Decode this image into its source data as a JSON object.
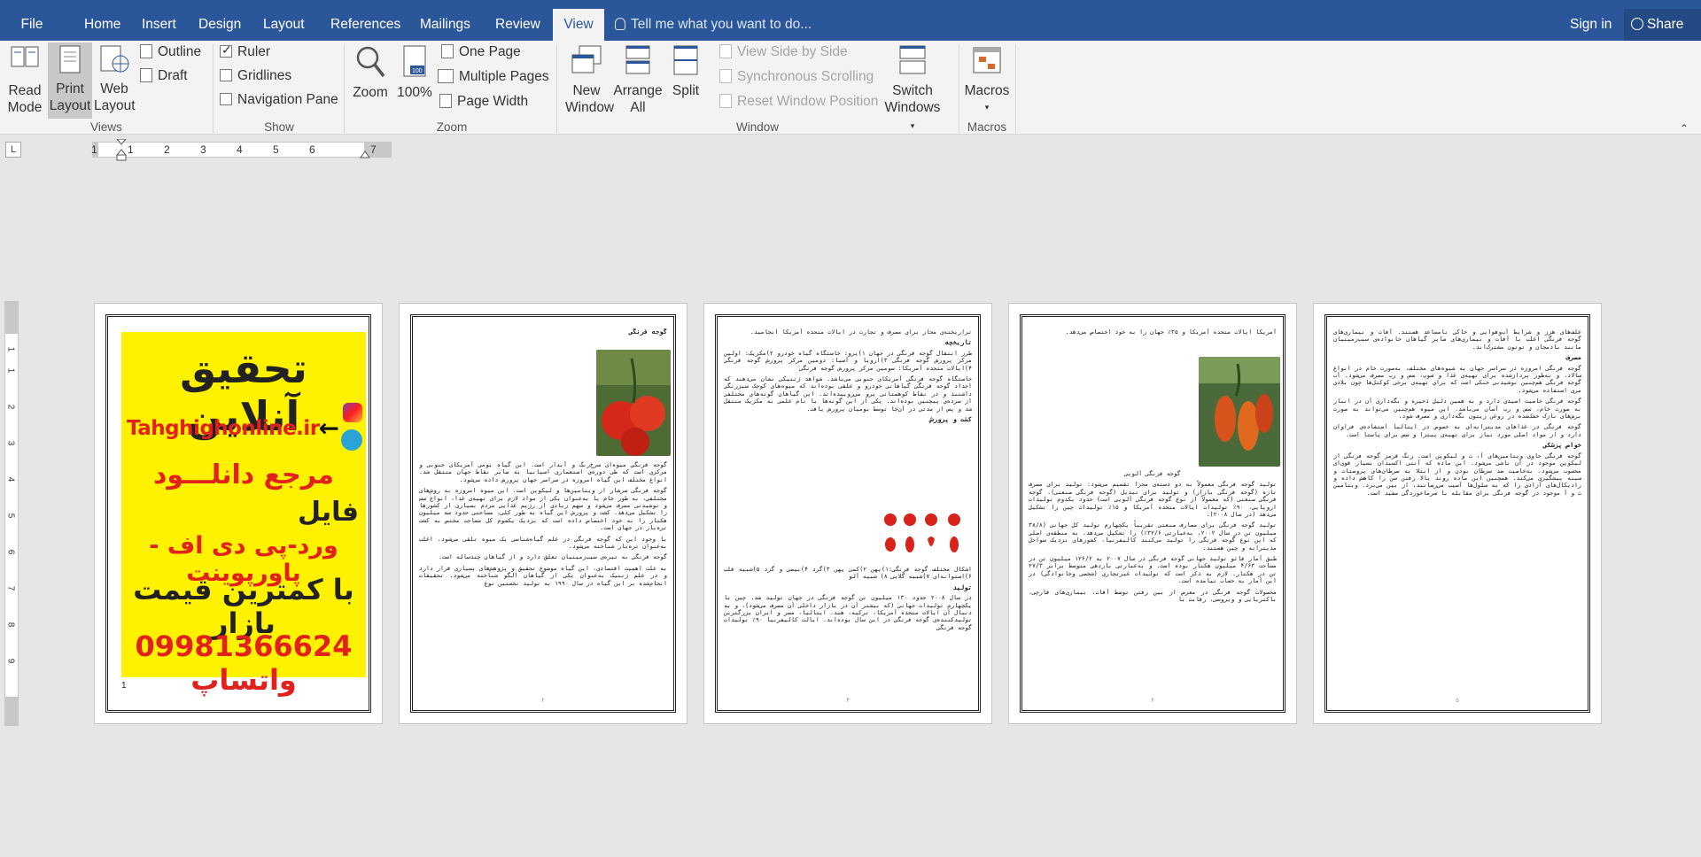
{
  "tabs": {
    "file": "File",
    "items": [
      "Home",
      "Insert",
      "Design",
      "Layout",
      "References",
      "Mailings",
      "Review",
      "View"
    ],
    "active": "View",
    "tell_me": "Tell me what you want to do...",
    "sign_in": "Sign in",
    "share": "Share"
  },
  "ribbon": {
    "views": {
      "label": "Views",
      "read_mode": [
        "Read",
        "Mode"
      ],
      "print_layout": [
        "Print",
        "Layout"
      ],
      "web_layout": [
        "Web",
        "Layout"
      ],
      "outline": "Outline",
      "draft": "Draft"
    },
    "show": {
      "label": "Show",
      "ruler": "Ruler",
      "gridlines": "Gridlines",
      "navigation_pane": "Navigation Pane",
      "ruler_checked": true,
      "gridlines_checked": false,
      "navigation_checked": false
    },
    "zoom": {
      "label": "Zoom",
      "zoom": "Zoom",
      "hundred": "100%",
      "one_page": "One Page",
      "multiple_pages": "Multiple Pages",
      "page_width": "Page Width"
    },
    "window": {
      "label": "Window",
      "new_window": [
        "New",
        "Window"
      ],
      "arrange_all": [
        "Arrange",
        "All"
      ],
      "split": "Split",
      "view_side_by_side": "View Side by Side",
      "sync_scrolling": "Synchronous Scrolling",
      "reset_window": "Reset Window Position",
      "switch_windows": [
        "Switch",
        "Windows"
      ]
    },
    "macros": {
      "label": "Macros",
      "macros": "Macros"
    }
  },
  "ruler": {
    "numbers": [
      "1",
      "1",
      "2",
      "3",
      "4",
      "5",
      "6",
      "7"
    ],
    "vertical_numbers": [
      "1",
      "1",
      "2",
      "3",
      "4",
      "5",
      "6",
      "7",
      "8",
      "9"
    ]
  },
  "pages": {
    "p1": {
      "ad_line1": "تحقیق آنلاین",
      "ad_line2": "Tahghighonline.ir",
      "ad_line3": "مرجع دانلـــود",
      "ad_line4": "فایل",
      "ad_line5": "ورد-پی دی اف - پاورپوینت",
      "ad_line6": "با کمترین قیمت بازار",
      "ad_line7": "09981366624 واتساپ",
      "page_mark": "1"
    },
    "p2": {
      "title": "گوجه فرنگی",
      "para1": "گوجه فرنگی میوه‌ای سرخ‌رنگ و آبدار است. این گیاه بومی آمریکای جنوبی و مرکزی است که طی دوره‌ی استعماری اسپانیا به سایر نقاط جهان منتقل شد. انواع مختلف این گیاه امروزه در سراسر جهان پرورش داده می‌شود.",
      "para2": "گوجه فرنگی سرشار از ویتامین‌ها و لیکوپن است. این میوه امروزه به روش‌های مختلفی، به طور خام یا به‌عنوان یکی از مواد لازم برای تهیه‌ی غذا، انواع سس و نوشیدنی مصرف می‌شود و سهم زیادی از رژیم غذایی مردم بسیاری از کشورها را تشکیل می‌دهد. کشت و پرورش این گیاه به طور کلی، مساحتی حدود سه میلیون هکتار را به خود اختصاص داده است که نزدیک یکسوم کل مساحت مختص به کشت تره‌بار در جهان است.",
      "para3": "با وجود این که گوجه فرنگی در علم گیاه‌شناسی یک میوه تلقی می‌شود، اغلب به‌عنوان تره‌بار شناخته می‌شود.",
      "para4": "گوجه فرنگی به تیره‌ی سیب‌زمینیان تعلق دارد و از گیاهان چندساله است.",
      "para5": "به علت اهمیت اقتصادی، این گیاه موضوع تحقیق و پژوهش‌های بسیاری قرار دارد و در علم ژنتیک به‌عنوان یکی از گیاهان الگو شناخته می‌شود. تحقیقات انجام‌شده بر این گیاه در سال ۱۹۹۰ به تولید نخستین نوع"
    },
    "p3": {
      "para1": "تراریخته‌ی مجاز برای مصرف و تجارت در ایالات متحده آمریکا انجامید.",
      "h1": "تاریخچه",
      "para2": "طرز انتقال گوجه فرنگی در جهان ۱)پرو: خاستگاه گیاه خودرو ۲)مکزیک: اولین مرکز پرورش گوجه فرنگی ۳)اروپا و آسیا: دومین مرکز پرورش گوجه فرنگی ۴)ایالات متحده آمریکا: سومین مرکز پرورش گوجه فرنگی",
      "para3": "خاستگاه گوجه فرنگی آمریکای جنوبی می‌باشد. شواهد ژنتیکی نشان می‌دهند که اجداد گوجه فرنگی گیاهانی خودرو و علفی بوده‌اند که میوه‌های کوچک سبزرنگی داشتند و در نقاط کوهستانی پرو می‌روییده‌اند. این گیاهان گونه‌های مختلفی از سرده‌ی پیچنین بوده‌اند. یکی از این گونه‌ها با نام علمی به مکزیک منتقل شد و پس از مدتی در آن‌جا توسط بومیان پرورش یافت.",
      "h2": "کشت و پرورش",
      "caption": "اشکال مختلف گوجه فرنگی:۱)پهن ۲)کمی پهن ۳)گرد ۴)بیضی و گرد ۵)شبیه قلب ۶)استوانه‌ای ۷)شبیه گلابی ۸) شبیه آلو",
      "h3": "تولید",
      "para4": "در سال ۲۰۰۸ حدود ۱۳۰ میلیون تن گوجه فرنگی در جهان تولید شد. چین با یکچهارم تولیدات جهانی (که بیشتر آن در بازار داخلی آن مصرف می‌شود)، و به دنبال آن ایالات متحده آمریکا، ترکیه، هند، ایتالیا، مصر و ایران بزرگترین تولیدکننده‌ی گوجه فرنگی در این سال بوده‌اند. ایالت کالیفرنیا ۹۰٪ تولیدات گوجه فرنگی"
    },
    "p4": {
      "para1": "آمریکا ایالات متحده آمریکا و ۳۵٪ جهان را به خود اختصاص می‌دهد.",
      "caption": "گوجه فرنگی آلویی",
      "para2": "تولید گوجه فرنگی معمولاً به دو دسته‌ی مجزا تقسیم می‌شود: تولید برای مصرف تازه (گوجه فرنگی بازار) و تولید برای تبدیل (گوجه فرنگی صنعتی). گوجه فرنگی صنعتی (که معمولاً از نوع گوجه فرنگی آلویی است) حدود یکدوم تولیدات اروپایی، ۹۰٪ تولیدات ایالات متحده آمریکا و ۱۵٪ تولیدات چین را تشکیل می‌دهد (در سال ۲۰۰۸).",
      "para3": "تولید گوجه فرنگی برای مصارف صنعتی تقریباً یکچهارم تولید کل جهانی (۳۸/۸ میلیون تن در سال ۲۰۰۲، به‌عبارتی ۳۲/۶٪) را تشکیل می‌دهد. به منطقه‌ی اصلی که این نوع گوجه فرنگی را تولید می‌کنند کالیفرنیا، کشورهای نزدیک سواحل مدیترانه و چین هستند.",
      "para4": "طبق آمار فائو تولید جهانی گوجه فرنگی در سال ۲۰۰۷ به ۱۲۶/۲ میلیون تن در مساحت ۴/۶۳ میلیون هکتار بوده است. و به‌عبارتی بازدهی متوسط برابر ۲۷/۳ تن در هکتار. لازم به ذکر است که تولیدات غیرتجاری (شخصی وخانوادگی) در این آمار به حساب نیامده است.",
      "para5": "محصولات گوجه فرنگی در معرض از بین رفتن توسط آفات، بیماری‌های قارچی، باکتریایی و ویروسی، رقابت با"
    },
    "p5": {
      "para1": "علف‌های هرز و شرایط آب‌وهوایی و خاکی نامساعد هستند. آفات و بیماری‌های گوجه فرنگی اغلب با آفات و بیماری‌های سایر گیاهان خانواده‌ی سیب‌زمینیان مانند بادمجان و توتون مشترک‌اند.",
      "h1": "مصرف",
      "para2": "گوجه فرنگی امروزه در سراسر جهان به شیوه‌های مختلف، به‌صورت خام در انواع سالاد، و به‌طور پرداز‌شده برای تهیه‌ی غذا و سوپ، سس و رب مصرف می‌شود. آب گوجه فرنگی هم‌چنین نوشیدنی خنکی است که برای تهیه‌ی برخی کوکتل‌ها چون بلادی مری استفاده می‌شود.",
      "para3": "گوجه فرنگی خاصیت اسیدی دارد و به همین دلیل ذخیره و نگه‌داری آن در انبار به صورت خام، سس و رب آسان می‌باشد. این میوه هم‌چنین می‌تواند به صورت برش‌های نازک خشک‌شده در روغن زیتون نگه‌داری و مصرف شود.",
      "para4": "گوجه فرنگی در غذاهای مدیترانه‌ای به خصوص در ایتالیا استفاده‌ی فراوان دارد و از مواد اصلی مورد نیاز برای تهیه‌ی پیتزا و سس برای پاستا است.",
      "h2": "خواص پزشکی",
      "para5": "گوجه فرنگی حاوی ویتامین‌های آ، ث و لیکوپن است. رنگ قرمز گوجه فرنگی از لیکوپن موجود در آن ناشی می‌شود. این ماده که آنتی اکسیدان بسیار قوی‌ای محسوب می‌شود، به‌خاصیت ضد سرطان بودن و از ابتلا به سرطان‌های پروستات و سینه پیشگیری می‌کند. همچنین این ماده روند بالا رفتن سن را کاهش داده و رادیکال‌های آزادی را که به سلول‌ها آسیب می‌رسانند، از بین می‌برد. ویتامین ث و آ موجود در گوجه فرنگی برای مقابله با سرماخوردگی مفید است."
    }
  }
}
